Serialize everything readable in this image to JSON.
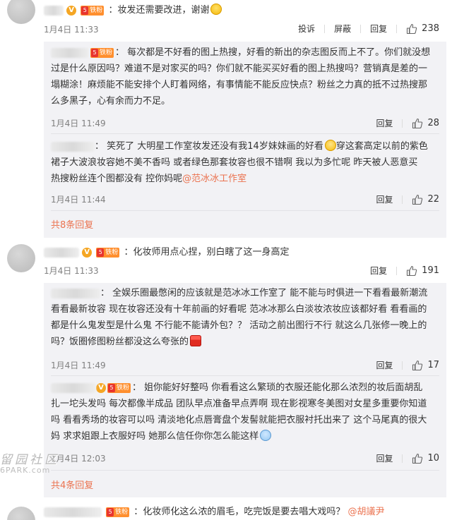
{
  "comments": [
    {
      "text": "妆发还需要改进，谢谢",
      "time": "1月4日 11:33",
      "actions": [
        "投诉",
        "屏蔽",
        "回复"
      ],
      "likes": "238",
      "replies": [
        {
          "lines": [
            "每次都是不好看的图上热搜，好看的新出的杂志图反而上不了。你们就没想",
            "过是什么原因吗？难道不是对家买的吗？你们就不能买买好看的图上热搜吗？营销真是差的一",
            "塌糊涂！麻烦能不能安排个人盯着网络，有事情能不能反应快点？粉丝之力真的抵不过热搜那",
            "么多黑子，心有余而力不足。"
          ],
          "time": "1月4日 11:49",
          "reply_label": "回复",
          "likes": "28"
        },
        {
          "lines": [
            "笑死了 大明星工作室妆发还没有我14岁妹妹画的好看",
            "穿这套高定以前的紫色",
            "裙子大波浪妆容她不美不香吗  或者绿色那套妆容也很不错啊  我以为多忙呢  昨天被人恶意买",
            "热搜粉丝连个图都没有  控你妈呢",
            "@范冰冰工作室"
          ],
          "time": "1月4日 11:44",
          "reply_label": "回复",
          "likes": "22"
        }
      ],
      "more": "共8条回复"
    },
    {
      "text": "化妆师用点心捏，别白瞎了这一身高定",
      "time": "1月4日 11:33",
      "actions": [
        "回复"
      ],
      "likes": "191",
      "replies": [
        {
          "lines": [
            "全娱乐圈最憋闲的应该就是范冰冰工作室了 能不能与时俱进一下看看最新潮流",
            "看看最新妆容 现在妆容还没有十年前画的好看呢 范冰冰那么白淡妆浓妆应该都好看 看看画的",
            "都是什么鬼发型是什么鬼 不行能不能请外包？？ 活动之前出图行不行 就这么几张修一晚上的",
            "吗？饭圈修图粉丝都没这么夸张的"
          ],
          "time": "1月4日 11:49",
          "reply_label": "回复",
          "likes": "17"
        },
        {
          "lines": [
            "姐你能好好整吗 你看看这么繁琐的衣服还能化那么浓烈的妆后面胡乱",
            "扎一坨头发吗 每次都像半成品 团队早点准备早点弄啊 现在影视寒冬美图对女星多重要你知道",
            "吗 看看秀场的妆容可以吗 清淡地化点唇膏盘个发髻就能把衣服衬托出来了 这个马尾真的很大",
            "妈 求求姐跟上衣服好吗 她那么信任你你怎么能这样"
          ],
          "time": "1月4日 12:03",
          "reply_label": "回复",
          "likes": "10"
        }
      ],
      "more": "共4条回复"
    },
    {
      "text": "化妆师化这么浓的眉毛，吃完饭是要去唱大戏吗？",
      "mention": "@胡議尹"
    }
  ],
  "badges": {
    "verified": "V",
    "fan": "铁粉",
    "level": "5"
  },
  "watermark": {
    "cn": "留园社区",
    "en": "6PARK.com"
  },
  "colors": {
    "accent": "#eb7350",
    "reply_bg": "#f2f2f5",
    "meta": "#808080"
  }
}
